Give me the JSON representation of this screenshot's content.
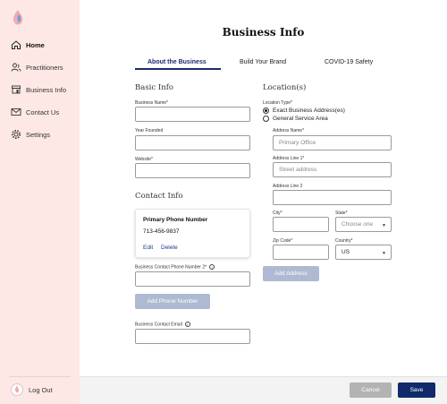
{
  "sidebar": {
    "items": [
      {
        "label": "Home",
        "icon": "home-icon",
        "active": true
      },
      {
        "label": "Practitioners",
        "icon": "people-icon"
      },
      {
        "label": "Business Info",
        "icon": "store-icon"
      },
      {
        "label": "Contact Us",
        "icon": "mail-icon"
      },
      {
        "label": "Settings",
        "icon": "gear-icon"
      }
    ],
    "logout_label": "Log Out"
  },
  "header": {
    "title": "Business Info"
  },
  "tabs": [
    {
      "label": "About the Business",
      "active": true
    },
    {
      "label": "Build Your Brand"
    },
    {
      "label": "COVID-19 Safety"
    }
  ],
  "basic_info": {
    "heading": "Basic Info",
    "business_name_label": "Business Name*",
    "year_founded_label": "Year Founded",
    "website_label": "Website*"
  },
  "contact_info": {
    "heading": "Contact Info",
    "card_title": "Primary Phone Number",
    "card_number": "713-456-9837",
    "edit_label": "Edit",
    "delete_label": "Delete",
    "phone2_label": "Business Contact Phone Number 2*",
    "add_phone_label": "Add Phone Number",
    "email_label": "Business Contact Email"
  },
  "location": {
    "heading": "Location(s)",
    "type_label": "Location Type*",
    "option_exact": "Exact Business Address(es)",
    "option_general": "General Service Area",
    "address_name_label": "Address Name*",
    "address_name_placeholder": "Primary Office",
    "line1_label": "Address Line 1*",
    "line1_placeholder": "Street address",
    "line2_label": "Address Line 2",
    "city_label": "City*",
    "state_label": "State*",
    "state_value": "Choose one",
    "zip_label": "Zip Code*",
    "country_label": "Country*",
    "country_value": "US",
    "add_address_label": "Add Address"
  },
  "footer": {
    "cancel_label": "Cancel",
    "save_label": "Save"
  },
  "colors": {
    "accent": "#1a2a6c",
    "sidebar_bg": "#fde8e6",
    "save_bg": "#102a6b"
  }
}
